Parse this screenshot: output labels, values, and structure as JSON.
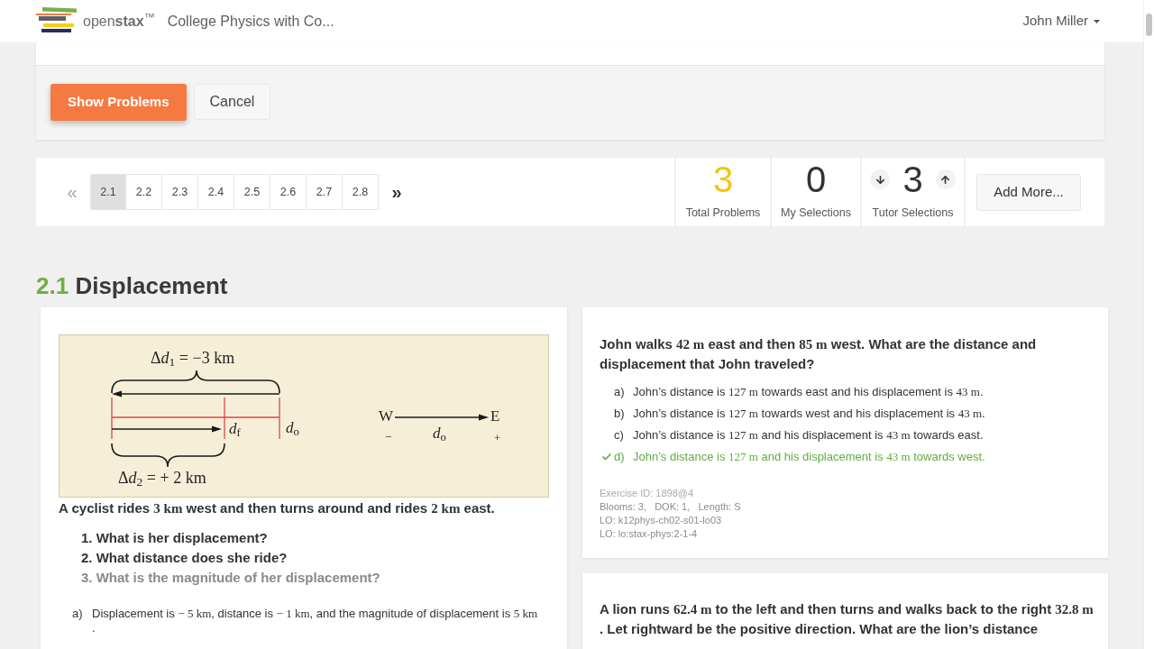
{
  "navbar": {
    "brand": "open**stax**$^{™}$",
    "book_title": "College Physics with Co...",
    "user": "John Miller"
  },
  "actions": [
    {
      "label": "Show Problems",
      "kind": "primary"
    },
    {
      "label": "Cancel",
      "kind": "secondary"
    }
  ],
  "pagination": {
    "previous": {
      "label": "«",
      "disabled": true
    },
    "pages": [
      {
        "label": "2.1",
        "selected": true
      },
      {
        "label": "2.2",
        "selected": false
      },
      {
        "label": "2.3",
        "selected": false
      },
      {
        "label": "2.4",
        "selected": false
      },
      {
        "label": "2.5",
        "selected": false
      },
      {
        "label": "2.6",
        "selected": false
      },
      {
        "label": "2.7",
        "selected": false
      },
      {
        "label": "2.8",
        "selected": false
      }
    ],
    "next": {
      "label": "»",
      "disabled": false
    }
  },
  "stats": [
    {
      "kind": "total",
      "value": "3",
      "label": "Total Problems"
    },
    {
      "kind": "plain",
      "value": "0",
      "label": "My Selections"
    },
    {
      "kind": "stepper",
      "value": "3",
      "label": "Tutor Selections"
    }
  ],
  "add_more": "Add More...",
  "section": {
    "number": "2.1",
    "title": "Displacement"
  },
  "left_card": {
    "figure": {
      "labels": [
        {
          "kind": "top_equation",
          "prefix": "Δ",
          "text": "*d*$_{1}$ = −3 km"
        },
        {
          "kind": "final_position",
          "text": "*d*$_{f}$"
        },
        {
          "kind": "initial_position",
          "text": "*d*$_{o}$"
        },
        {
          "kind": "west",
          "text": "W"
        },
        {
          "kind": "east",
          "text": "E"
        },
        {
          "kind": "minus",
          "text": "−"
        },
        {
          "kind": "axis_origin",
          "text": "*d*$_{o}$"
        },
        {
          "kind": "plus",
          "text": "+"
        },
        {
          "kind": "bottom_equation",
          "prefix": "Δ",
          "text": "*d*$_{2}$ = + 2 km"
        }
      ]
    },
    "stem": [
      {
        "kind": "text",
        "text": "A cyclist rides "
      },
      {
        "kind": "math",
        "text": "3 km"
      },
      {
        "kind": "text",
        "text": " west and then turns around and rides "
      },
      {
        "kind": "math",
        "text": "2 km"
      },
      {
        "kind": "text",
        "text": " east."
      }
    ],
    "questions": [
      {
        "number": "1.",
        "text": "What is her displacement?",
        "muted": false
      },
      {
        "number": "2.",
        "text": "What distance does she ride?",
        "muted": false
      },
      {
        "number": "3.",
        "text": "What is the magnitude of her displacement?",
        "muted": true
      }
    ],
    "answers": [
      {
        "letter": "a)",
        "lines": [
          [
            {
              "kind": "text",
              "text": "Displacement is "
            },
            {
              "kind": "math",
              "text": "− 5 km"
            },
            {
              "kind": "text",
              "text": ", distance is "
            },
            {
              "kind": "math",
              "text": "− 1 km"
            },
            {
              "kind": "text",
              "text": ", and the magnitude of displacement is "
            },
            {
              "kind": "math",
              "text": "5 km"
            }
          ],
          [
            {
              "kind": "text",
              "text": "."
            }
          ]
        ]
      }
    ]
  },
  "right_cards": [
    {
      "question": [
        [
          {
            "kind": "text",
            "text": "John walks "
          },
          {
            "kind": "math",
            "text": "42 m"
          },
          {
            "kind": "text",
            "text": " east and then "
          },
          {
            "kind": "math",
            "text": "85 m"
          },
          {
            "kind": "text",
            "text": " west. What are the distance and"
          }
        ],
        [
          {
            "kind": "text",
            "text": "displacement that John traveled?"
          }
        ]
      ],
      "answers": [
        {
          "letter": "a)",
          "correct": false,
          "segments": [
            {
              "kind": "text",
              "text": "John’s distance is "
            },
            {
              "kind": "math",
              "text": "127 m"
            },
            {
              "kind": "text",
              "text": " towards east and his displacement is "
            },
            {
              "kind": "math",
              "text": "43 m"
            },
            {
              "kind": "text",
              "text": "."
            }
          ]
        },
        {
          "letter": "b)",
          "correct": false,
          "segments": [
            {
              "kind": "text",
              "text": "John’s distance is "
            },
            {
              "kind": "math",
              "text": "127 m"
            },
            {
              "kind": "text",
              "text": " towards west and his displacement is "
            },
            {
              "kind": "math",
              "text": "43 m"
            },
            {
              "kind": "text",
              "text": "."
            }
          ]
        },
        {
          "letter": "c)",
          "correct": false,
          "segments": [
            {
              "kind": "text",
              "text": "John’s distance is "
            },
            {
              "kind": "math",
              "text": "127 m"
            },
            {
              "kind": "text",
              "text": " and his displacement is "
            },
            {
              "kind": "math",
              "text": "43 m"
            },
            {
              "kind": "text",
              "text": " towards east."
            }
          ]
        },
        {
          "letter": "d)",
          "correct": true,
          "segments": [
            {
              "kind": "text",
              "text": "John’s distance is "
            },
            {
              "kind": "math",
              "text": "127 m"
            },
            {
              "kind": "text",
              "text": " and his displacement is "
            },
            {
              "kind": "math",
              "text": "43 m"
            },
            {
              "kind": "text",
              "text": " towards west."
            }
          ]
        }
      ],
      "meta": [
        "Exercise ID: 1898@4",
        "Blooms: 3,   DOK: 1,   Length: S",
        "LO: k12phys-ch02-s01-lo03",
        "LO: lo:stax-phys:2-1-4"
      ]
    },
    {
      "question": [
        [
          {
            "kind": "text",
            "text": "A lion runs "
          },
          {
            "kind": "math",
            "text": "62.4 m"
          },
          {
            "kind": "text",
            "text": " to the left and then turns and walks back to the right "
          },
          {
            "kind": "math",
            "text": "32.8 m"
          }
        ],
        [
          {
            "kind": "text",
            "text": ". Let rightward be the positive direction. What are the lion’s distance"
          }
        ]
      ]
    }
  ]
}
